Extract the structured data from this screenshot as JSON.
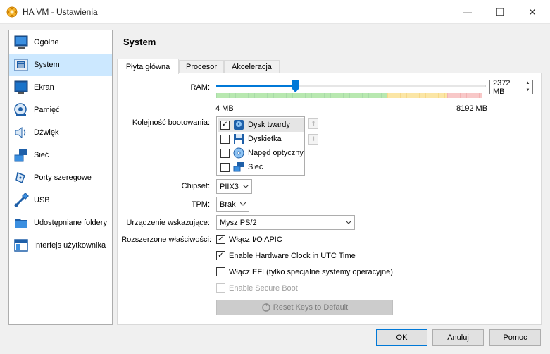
{
  "window": {
    "title": "HA VM - Ustawienia",
    "minimize": "—",
    "maximize": "☐",
    "close": "✕"
  },
  "sidebar": {
    "items": [
      {
        "label": "Ogólne",
        "icon": "monitor-icon"
      },
      {
        "label": "System",
        "icon": "chip-icon"
      },
      {
        "label": "Ekran",
        "icon": "display-icon"
      },
      {
        "label": "Pamięć",
        "icon": "storage-icon"
      },
      {
        "label": "Dźwięk",
        "icon": "speaker-icon"
      },
      {
        "label": "Sieć",
        "icon": "network-icon"
      },
      {
        "label": "Porty szeregowe",
        "icon": "serial-port-icon"
      },
      {
        "label": "USB",
        "icon": "usb-icon"
      },
      {
        "label": "Udostępniane foldery",
        "icon": "folder-icon"
      },
      {
        "label": "Interfejs użytkownika",
        "icon": "window-ui-icon"
      }
    ],
    "selected": "System"
  },
  "main": {
    "heading": "System",
    "tabs": [
      {
        "label": "Płyta główna"
      },
      {
        "label": "Procesor"
      },
      {
        "label": "Akceleracja"
      }
    ],
    "active_tab": "Płyta główna"
  },
  "motherboard": {
    "ram_label": "RAM:",
    "ram_value": "2372 MB",
    "ram_mb": 2372,
    "ram_min_label": "4 MB",
    "ram_max_label": "8192 MB",
    "ram_min": 4,
    "ram_max": 8192,
    "boot_label": "Kolejność bootowania:",
    "boot_items": [
      {
        "label": "Dysk twardy",
        "checked": "✓",
        "icon": "hard-disk-icon"
      },
      {
        "label": "Dyskietka",
        "checked": "",
        "icon": "floppy-icon"
      },
      {
        "label": "Napęd optyczny",
        "checked": "",
        "icon": "optical-drive-icon"
      },
      {
        "label": "Sieć",
        "checked": "",
        "icon": "network-icon"
      }
    ],
    "chipset_label": "Chipset:",
    "chipset_value": "PIIX3",
    "tpm_label": "TPM:",
    "tpm_value": "Brak",
    "pointing_label": "Urządzenie wskazujące:",
    "pointing_value": "Mysz PS/2",
    "extended_label": "Rozszerzone właściwości:",
    "options": [
      {
        "label": "Włącz I/O APIC",
        "checked": "✓",
        "enabled": true
      },
      {
        "label": "Enable Hardware Clock in UTC Time",
        "checked": "✓",
        "enabled": true
      },
      {
        "label": "Włącz EFI (tylko specjalne systemy operacyjne)",
        "checked": "",
        "enabled": true
      },
      {
        "label": "Enable Secure Boot",
        "checked": "",
        "enabled": false
      }
    ],
    "reset_keys": "Reset Keys to Default"
  },
  "footer": {
    "ok": "OK",
    "cancel": "Anuluj",
    "help": "Pomoc"
  },
  "colors": {
    "accent": "#0078d7",
    "selection": "#cce8ff"
  }
}
